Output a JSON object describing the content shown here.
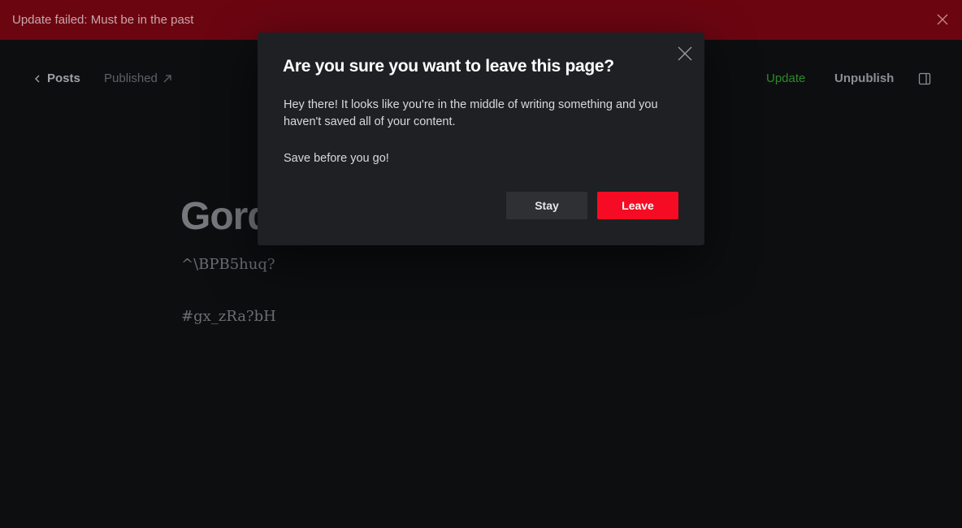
{
  "banner": {
    "message": "Update failed: Must be in the past",
    "close_icon": "close-icon"
  },
  "header": {
    "back_label": "Posts",
    "status_label": "Published",
    "update_label": "Update",
    "unpublish_label": "Unpublish",
    "colors": {
      "update": "#2c8a2c"
    }
  },
  "post": {
    "title": "Gord",
    "paragraphs": [
      "^\\BPB5huq?",
      "#gx_zRa?bH"
    ]
  },
  "modal": {
    "title": "Are you sure you want to leave this page?",
    "body_1": "Hey there! It looks like you're in the middle of writing something and you haven't saved all of your content.",
    "body_2": "Save before you go!",
    "stay_label": "Stay",
    "leave_label": "Leave",
    "colors": {
      "leave": "#f50b23",
      "banner": "#6b0611"
    }
  }
}
